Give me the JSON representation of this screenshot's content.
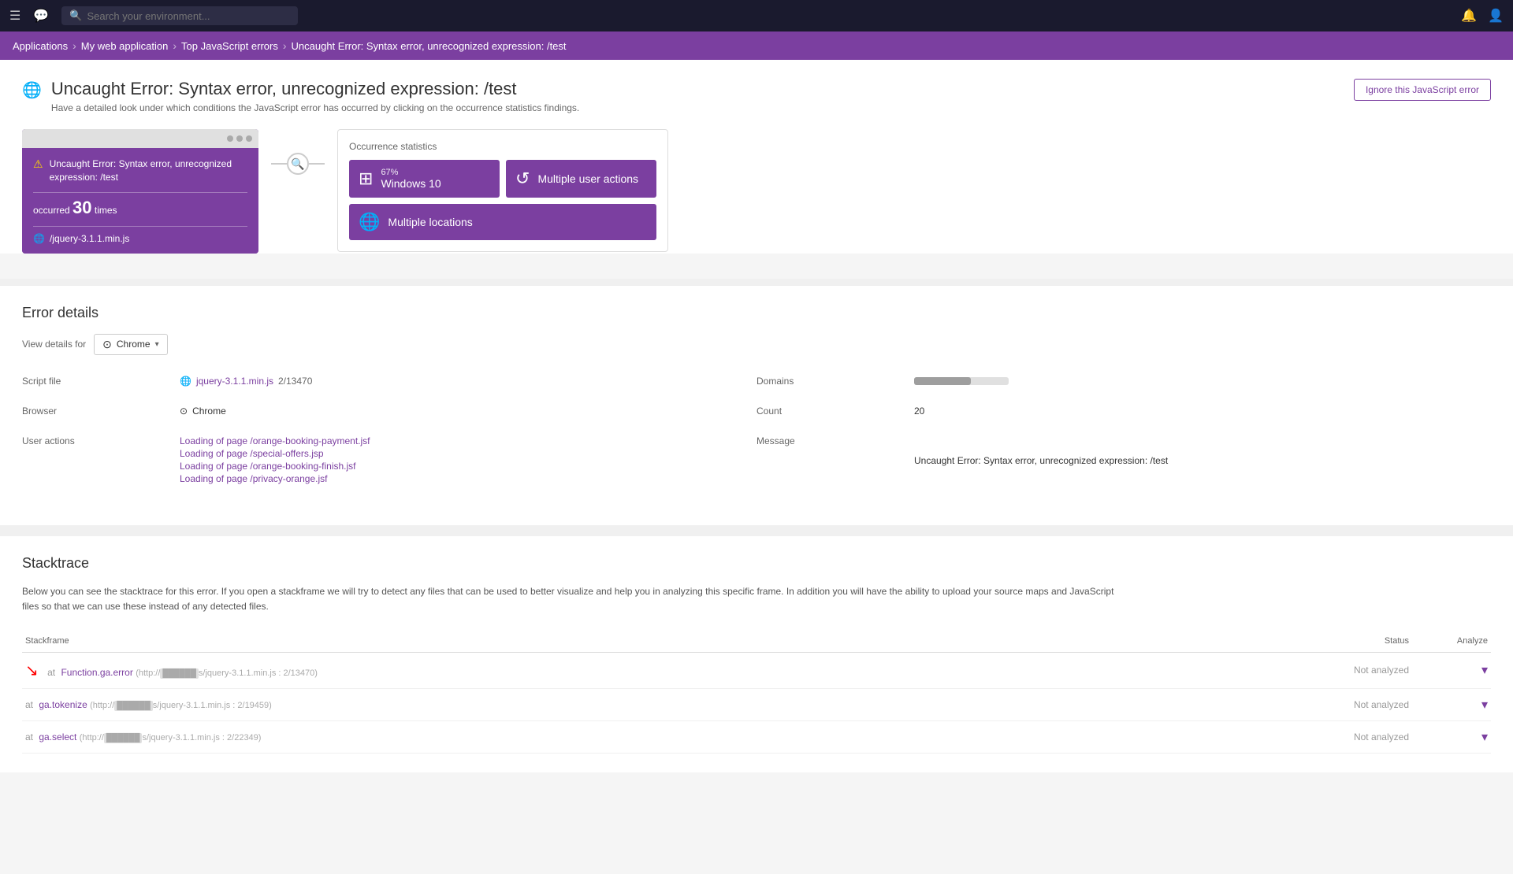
{
  "topnav": {
    "search_placeholder": "Search your environment...",
    "hamburger": "☰",
    "chat_icon": "💬",
    "search_icon": "🔍",
    "user_icon": "👤",
    "notif_icon": "🔔"
  },
  "breadcrumb": {
    "items": [
      {
        "label": "Applications",
        "active": false
      },
      {
        "label": "My web application",
        "active": false
      },
      {
        "label": "Top JavaScript errors",
        "active": false
      },
      {
        "label": "Uncaught Error: Syntax error, unrecognized expression: /test",
        "active": true
      }
    ]
  },
  "page": {
    "title": "Uncaught Error: Syntax error, unrecognized expression: /test",
    "subtitle": "Have a detailed look under which conditions the JavaScript error has occurred by clicking on the occurrence statistics findings.",
    "ignore_button": "Ignore this JavaScript error"
  },
  "error_card": {
    "error_text": "Uncaught Error: Syntax error, unrecognized expression: /test",
    "occurred_label": "occurred",
    "occurred_count": "30",
    "occurred_suffix": "times",
    "script_name": "/jquery-3.1.1.min.js"
  },
  "occurrence_stats": {
    "title": "Occurrence statistics",
    "windows_pct": "67%",
    "windows_label": "Windows 10",
    "user_actions_label": "Multiple user actions",
    "locations_label": "Multiple locations"
  },
  "error_details": {
    "section_title": "Error details",
    "view_details_label": "View details for",
    "browser_value": "Chrome",
    "fields": {
      "script_file_label": "Script file",
      "script_file_value": "jquery-3.1.1.min.js",
      "script_file_link": "2/13470",
      "browser_label": "Browser",
      "browser_value": "Chrome",
      "user_actions_label": "User actions",
      "user_actions": [
        "Loading of page /orange-booking-payment.jsf",
        "Loading of page /special-offers.jsp",
        "Loading of page /orange-booking-finish.jsf",
        "Loading of page /privacy-orange.jsf"
      ],
      "domains_label": "Domains",
      "count_label": "Count",
      "count_value": "20",
      "message_label": "Message",
      "message_value": "Uncaught Error: Syntax error, unrecognized expression: /test"
    }
  },
  "stacktrace": {
    "section_title": "Stacktrace",
    "description": "Below you can see the stacktrace for this error. If you open a stackframe we will try to detect any files that can be used to better visualize and help you in analyzing this specific frame. In addition you will have the ability to upload your source maps and JavaScript files so that we can use these instead of any detected files.",
    "column_stackframe": "Stackframe",
    "column_status": "Status",
    "column_analyze": "Analyze",
    "frames": [
      {
        "prefix": "at",
        "func": "Function.ga.error",
        "url": "(http://",
        "url_rest": "s/jquery-3.1.1.min.js : 2/13470)",
        "status": "Not analyzed"
      },
      {
        "prefix": "at",
        "func": "ga.tokenize",
        "url": "(http://",
        "url_rest": "s/jquery-3.1.1.min.js : 2/19459)",
        "status": "Not analyzed"
      },
      {
        "prefix": "at",
        "func": "ga.select",
        "url": "(http://",
        "url_rest": "s/jquery-3.1.1.min.js : 2/22349)",
        "status": "Not analyzed"
      }
    ]
  },
  "colors": {
    "purple": "#7b3fa0",
    "light_purple": "#9b59c0",
    "nav_bg": "#1a1a2e",
    "breadcrumb_bg": "#7b3fa0"
  }
}
